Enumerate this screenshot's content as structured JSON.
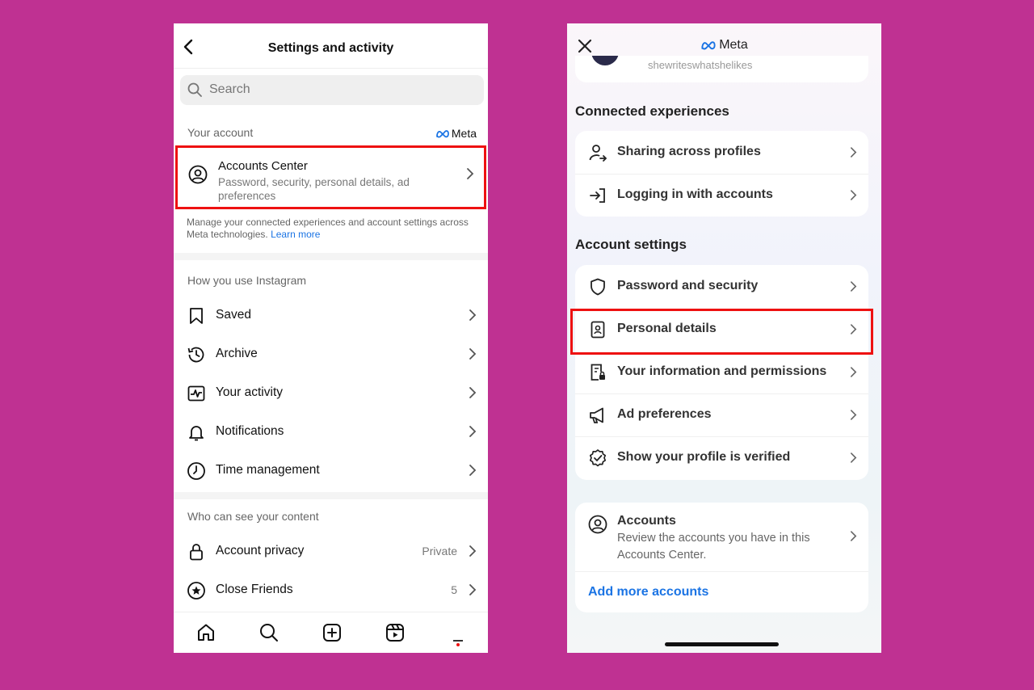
{
  "left": {
    "header": {
      "title": "Settings and activity",
      "back_icon": "back-arrow-icon"
    },
    "search": {
      "placeholder": "Search"
    },
    "your_account": {
      "label": "Your account",
      "meta_logo_text": "Meta",
      "accounts_center": {
        "title": "Accounts Center",
        "subtitle": "Password, security, personal details, ad preferences"
      },
      "manage_text": "Manage your connected experiences and account settings across Meta technologies.",
      "learn_more": "Learn more"
    },
    "how_you_use": {
      "label": "How you use Instagram",
      "items": [
        {
          "label": "Saved",
          "icon": "bookmark-icon"
        },
        {
          "label": "Archive",
          "icon": "archive-icon"
        },
        {
          "label": "Your activity",
          "icon": "activity-icon"
        },
        {
          "label": "Notifications",
          "icon": "bell-icon"
        },
        {
          "label": "Time management",
          "icon": "clock-icon"
        }
      ]
    },
    "who_can_see": {
      "label": "Who can see your content",
      "items": [
        {
          "label": "Account privacy",
          "value": "Private",
          "icon": "lock-icon"
        },
        {
          "label": "Close Friends",
          "value": "5",
          "icon": "star-icon"
        }
      ]
    },
    "bottom_nav": [
      "home-icon",
      "search-icon",
      "create-icon",
      "reels-icon",
      "profile-icon"
    ]
  },
  "right": {
    "header": {
      "brand": "Meta",
      "close_icon": "close-icon"
    },
    "top_card_name": "shewriteswhatshelikes",
    "connected": {
      "heading": "Connected experiences",
      "items": [
        {
          "label": "Sharing across profiles",
          "icon": "share-profile-icon"
        },
        {
          "label": "Logging in with accounts",
          "icon": "login-icon"
        }
      ]
    },
    "account_settings": {
      "heading": "Account settings",
      "items": [
        {
          "label": "Password and security",
          "icon": "shield-icon"
        },
        {
          "label": "Personal details",
          "icon": "id-card-icon"
        },
        {
          "label": "Your information and permissions",
          "icon": "info-lock-icon"
        },
        {
          "label": "Ad preferences",
          "icon": "megaphone-icon"
        },
        {
          "label": "Show your profile is verified",
          "icon": "verified-badge-icon"
        }
      ]
    },
    "accounts": {
      "title": "Accounts",
      "subtitle": "Review the accounts you have in this Accounts Center.",
      "add_more": "Add more accounts"
    }
  },
  "colors": {
    "background": "#bf3192",
    "highlight": "#e11111",
    "link": "#1b74e4"
  }
}
